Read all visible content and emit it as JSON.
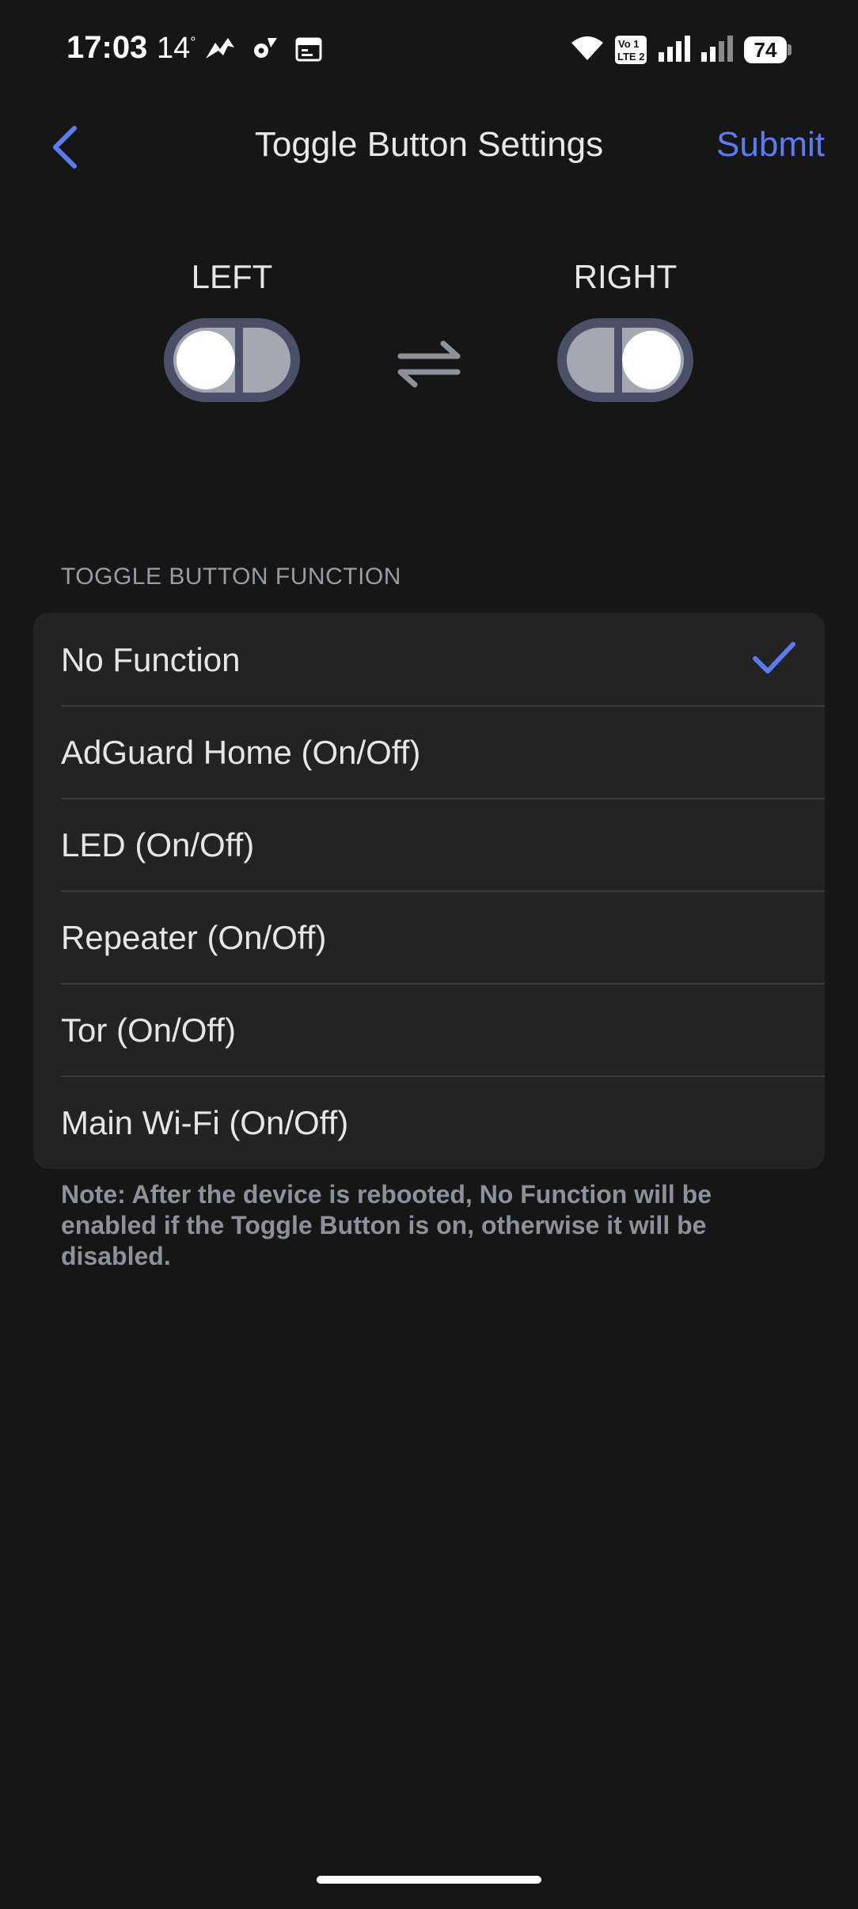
{
  "status_bar": {
    "time": "17:03",
    "temperature": "14",
    "temperature_unit": "°",
    "battery": "74",
    "icons": [
      "weather-icon",
      "settings-gear-icon",
      "calendar-icon",
      "wifi-icon",
      "volte-icon",
      "signal-sim1-icon",
      "signal-sim2-icon",
      "battery-icon"
    ]
  },
  "header": {
    "title": "Toggle Button Settings",
    "submit_label": "Submit",
    "back_icon": "chevron-left-icon"
  },
  "toggle_preview": {
    "left_label": "LEFT",
    "right_label": "RIGHT",
    "swap_icon": "swap-arrows-icon"
  },
  "function_section": {
    "title": "TOGGLE BUTTON FUNCTION",
    "selected": "No Function",
    "options": [
      {
        "label": "No Function",
        "selected": true
      },
      {
        "label": "AdGuard Home (On/Off)",
        "selected": false
      },
      {
        "label": "LED (On/Off)",
        "selected": false
      },
      {
        "label": "Repeater (On/Off)",
        "selected": false
      },
      {
        "label": "Tor (On/Off)",
        "selected": false
      },
      {
        "label": "Main Wi-Fi (On/Off)",
        "selected": false
      }
    ]
  },
  "note": "Note: After the device is rebooted, No Function will be enabled if the Toggle Button is on, otherwise it will be disabled.",
  "colors": {
    "background": "#161617",
    "card": "#232324",
    "accent": "#5b7cf0",
    "toggle_border": "#4a5068",
    "toggle_track": "#a4a8b2",
    "muted_text": "#8e909a"
  }
}
